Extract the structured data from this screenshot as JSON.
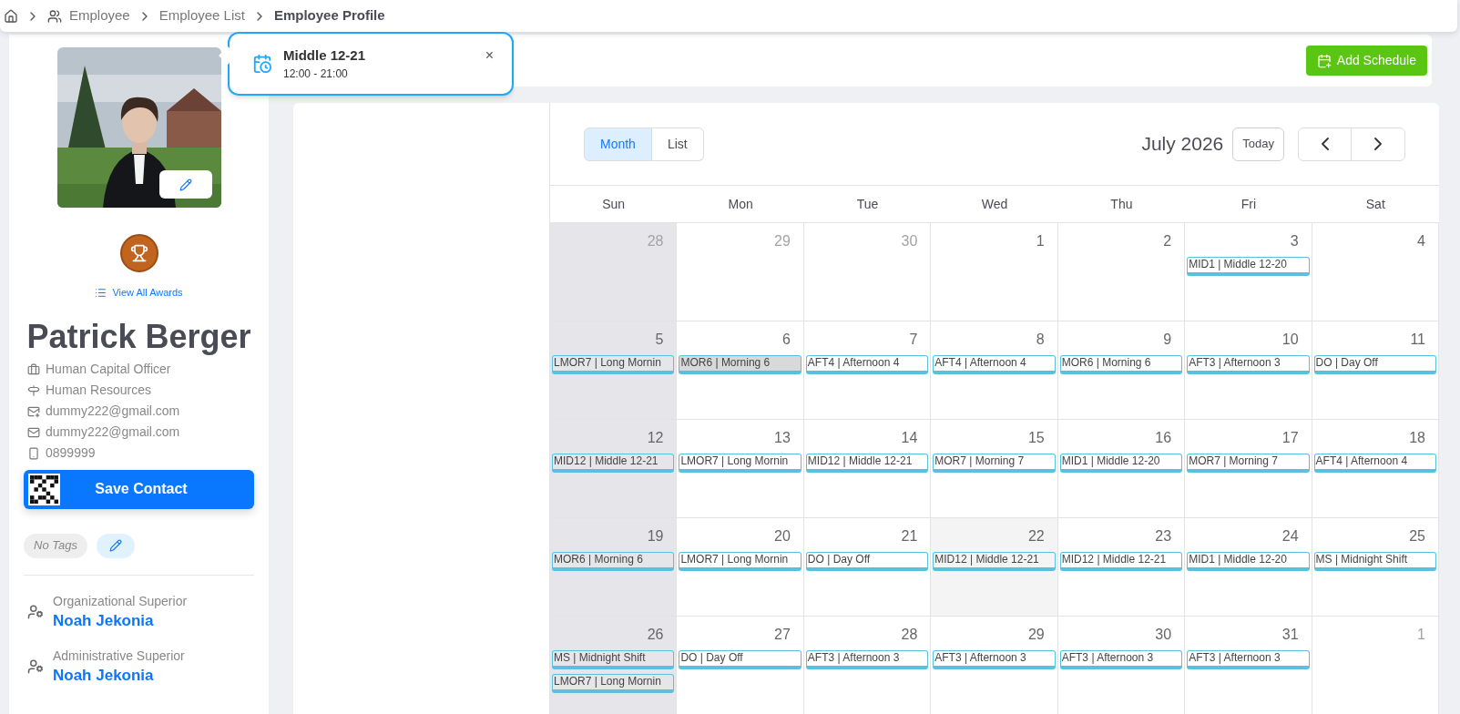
{
  "breadcrumb": [
    {
      "label": "Employee",
      "current": false
    },
    {
      "label": "Employee List",
      "current": false
    },
    {
      "label": "Employee Profile",
      "current": true
    }
  ],
  "popover": {
    "title": "Middle 12-21",
    "time": "12:00 - 21:00",
    "close": "×"
  },
  "profile": {
    "awards_link": "View All Awards",
    "name": "Patrick Berger",
    "details": [
      {
        "kind": "job",
        "text": "Human Capital Officer"
      },
      {
        "kind": "department",
        "text": "Human Resources"
      },
      {
        "kind": "work_email",
        "text": "dummy222@gmail.com"
      },
      {
        "kind": "email",
        "text": "dummy222@gmail.com"
      },
      {
        "kind": "phone",
        "text": "0899999"
      }
    ],
    "save_button": "Save Contact",
    "tags_placeholder": "No Tags",
    "superiors": [
      {
        "label": "Organizational Superior",
        "name": "Noah Jekonia"
      },
      {
        "label": "Administrative Superior",
        "name": "Noah Jekonia"
      }
    ]
  },
  "add_schedule": "Add Schedule",
  "calendar": {
    "views": [
      {
        "label": "Month",
        "selected": true
      },
      {
        "label": "List",
        "selected": false
      }
    ],
    "title": "July 2026",
    "today_button": "Today",
    "weekdays": [
      {
        "label": "Sun",
        "weekend": true
      },
      {
        "label": "Mon",
        "weekend": false
      },
      {
        "label": "Tue",
        "weekend": false
      },
      {
        "label": "Wed",
        "weekend": false
      },
      {
        "label": "Thu",
        "weekend": false
      },
      {
        "label": "Fri",
        "weekend": false
      },
      {
        "label": "Sat",
        "weekend": false
      }
    ],
    "weeks": [
      [
        {
          "number": "28",
          "kind": "other"
        },
        {
          "number": "29",
          "kind": "other"
        },
        {
          "number": "30",
          "kind": "other"
        },
        {
          "number": "1",
          "kind": "day"
        },
        {
          "number": "2",
          "kind": "day"
        },
        {
          "number": "3",
          "kind": "day",
          "events": [
            {
              "label": "MID1 | Middle 12-20",
              "selected": false
            }
          ]
        },
        {
          "number": "4",
          "kind": "day"
        }
      ],
      [
        {
          "number": "5",
          "kind": "day",
          "events": [
            {
              "label": "LMOR7 | Long Mornin",
              "selected": false
            }
          ]
        },
        {
          "number": "6",
          "kind": "day",
          "events": [
            {
              "label": "MOR6 | Morning 6",
              "selected": true
            }
          ]
        },
        {
          "number": "7",
          "kind": "day",
          "events": [
            {
              "label": "AFT4 | Afternoon 4",
              "selected": false
            }
          ]
        },
        {
          "number": "8",
          "kind": "day",
          "events": [
            {
              "label": "AFT4 | Afternoon 4",
              "selected": false
            }
          ]
        },
        {
          "number": "9",
          "kind": "day",
          "events": [
            {
              "label": "MOR6 | Morning 6",
              "selected": false
            }
          ]
        },
        {
          "number": "10",
          "kind": "day",
          "events": [
            {
              "label": "AFT3 | Afternoon 3",
              "selected": false
            }
          ]
        },
        {
          "number": "11",
          "kind": "day",
          "events": [
            {
              "label": "DO | Day Off",
              "selected": false
            }
          ]
        }
      ],
      [
        {
          "number": "12",
          "kind": "day",
          "events": [
            {
              "label": "MID12 | Middle 12-21",
              "selected": false
            }
          ]
        },
        {
          "number": "13",
          "kind": "day",
          "events": [
            {
              "label": "LMOR7 | Long Mornin",
              "selected": false
            }
          ]
        },
        {
          "number": "14",
          "kind": "day",
          "events": [
            {
              "label": "MID12 | Middle 12-21",
              "selected": false
            }
          ]
        },
        {
          "number": "15",
          "kind": "day",
          "events": [
            {
              "label": "MOR7 | Morning 7",
              "selected": false
            }
          ]
        },
        {
          "number": "16",
          "kind": "day",
          "events": [
            {
              "label": "MID1 | Middle 12-20",
              "selected": false
            }
          ]
        },
        {
          "number": "17",
          "kind": "day",
          "events": [
            {
              "label": "MOR7 | Morning 7",
              "selected": false
            }
          ]
        },
        {
          "number": "18",
          "kind": "day",
          "events": [
            {
              "label": "AFT4 | Afternoon 4",
              "selected": false
            }
          ]
        }
      ],
      [
        {
          "number": "19",
          "kind": "day",
          "events": [
            {
              "label": "MOR6 | Morning 6",
              "selected": false
            }
          ]
        },
        {
          "number": "20",
          "kind": "day",
          "events": [
            {
              "label": "LMOR7 | Long Mornin",
              "selected": false
            }
          ]
        },
        {
          "number": "21",
          "kind": "day",
          "events": [
            {
              "label": "DO | Day Off",
              "selected": false
            }
          ]
        },
        {
          "number": "22",
          "kind": "today",
          "events": [
            {
              "label": "MID12 | Middle 12-21",
              "selected": false
            }
          ]
        },
        {
          "number": "23",
          "kind": "day",
          "events": [
            {
              "label": "MID12 | Middle 12-21",
              "selected": false
            }
          ]
        },
        {
          "number": "24",
          "kind": "day",
          "events": [
            {
              "label": "MID1 | Middle 12-20",
              "selected": false
            }
          ]
        },
        {
          "number": "25",
          "kind": "day",
          "events": [
            {
              "label": "MS | Midnight Shift",
              "selected": false
            }
          ]
        }
      ],
      [
        {
          "number": "26",
          "kind": "day",
          "events": [
            {
              "label": "MS | Midnight Shift",
              "selected": false
            },
            {
              "label": "LMOR7 | Long Mornin",
              "selected": false
            }
          ]
        },
        {
          "number": "27",
          "kind": "day",
          "events": [
            {
              "label": "DO | Day Off",
              "selected": false
            }
          ]
        },
        {
          "number": "28",
          "kind": "day",
          "events": [
            {
              "label": "AFT3 | Afternoon 3",
              "selected": false
            }
          ]
        },
        {
          "number": "29",
          "kind": "day",
          "events": [
            {
              "label": "AFT3 | Afternoon 3",
              "selected": false
            }
          ]
        },
        {
          "number": "30",
          "kind": "day",
          "events": [
            {
              "label": "AFT3 | Afternoon 3",
              "selected": false
            }
          ]
        },
        {
          "number": "31",
          "kind": "day",
          "events": [
            {
              "label": "AFT3 | Afternoon 3",
              "selected": false
            }
          ]
        },
        {
          "number": "1",
          "kind": "other"
        }
      ]
    ]
  }
}
